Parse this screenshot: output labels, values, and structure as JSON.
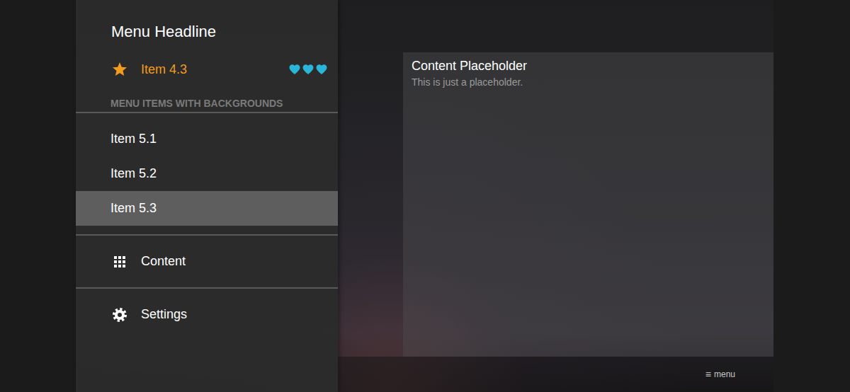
{
  "drawer": {
    "headline": "Menu Headline",
    "featured": {
      "label": "Item 4.3",
      "active": true,
      "hearts": 3
    },
    "subheader": "MENU ITEMS WITH BACKGROUNDS",
    "items": [
      {
        "label": "Item 5.1",
        "selected": false
      },
      {
        "label": "Item 5.2",
        "selected": false
      },
      {
        "label": "Item 5.3",
        "selected": true
      }
    ],
    "nav": [
      {
        "label": "Content"
      },
      {
        "label": "Settings"
      }
    ]
  },
  "card": {
    "title": "Content Placeholder",
    "text": "This is just a placeholder."
  },
  "bottom_bar": {
    "icon": "≡",
    "label": "menu"
  }
}
